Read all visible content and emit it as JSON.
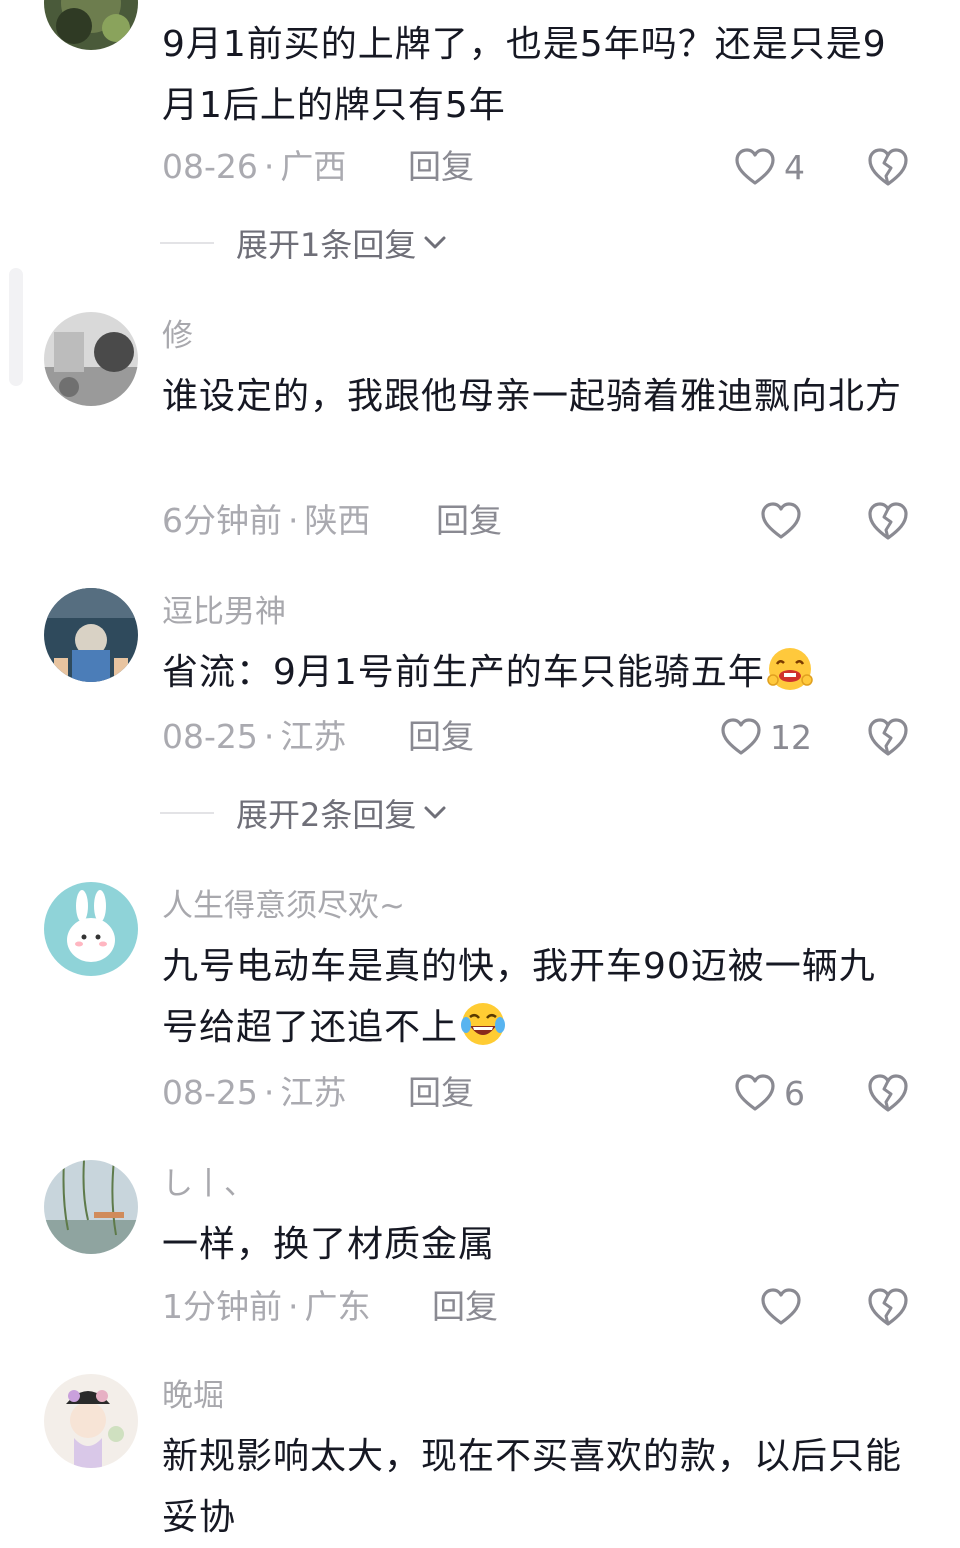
{
  "colors": {
    "text_primary": "#161823",
    "text_secondary": "#a8a8ad",
    "icon": "#8a8a92"
  },
  "comments": [
    {
      "username": "",
      "text": "9月1前买的上牌了，也是5年吗？还是只是9月1后上的牌只有5年",
      "time": "08-26",
      "region": "广西",
      "reply_label": "回复",
      "likes": "4",
      "expand_label": "展开1条回复"
    },
    {
      "username": "修",
      "text": "谁设定的，我跟他母亲一起骑着雅迪飘向北方",
      "time": "6分钟前",
      "region": "陕西",
      "reply_label": "回复",
      "likes": ""
    },
    {
      "username": "逗比男神",
      "text": "省流：9月1号前生产的车只能骑五年",
      "emoji": "hot-face-emoji",
      "time": "08-25",
      "region": "江苏",
      "reply_label": "回复",
      "likes": "12",
      "expand_label": "展开2条回复"
    },
    {
      "username": "人生得意须尽欢~",
      "text": "九号电动车是真的快，我开车90迈被一辆九号给超了还追不上",
      "emoji": "laughing-tears-emoji",
      "time": "08-25",
      "region": "江苏",
      "reply_label": "回复",
      "likes": "6"
    },
    {
      "username": "し丨、",
      "text": "一样，换了材质金属",
      "time": "1分钟前",
      "region": "广东",
      "reply_label": "回复",
      "likes": ""
    },
    {
      "username": "晚堀",
      "text": "新规影响太大，现在不买喜欢的款，以后只能妥协"
    }
  ],
  "icons": {
    "like": "heart-outline-icon",
    "dislike": "broken-heart-icon",
    "expand": "chevron-down-icon"
  }
}
